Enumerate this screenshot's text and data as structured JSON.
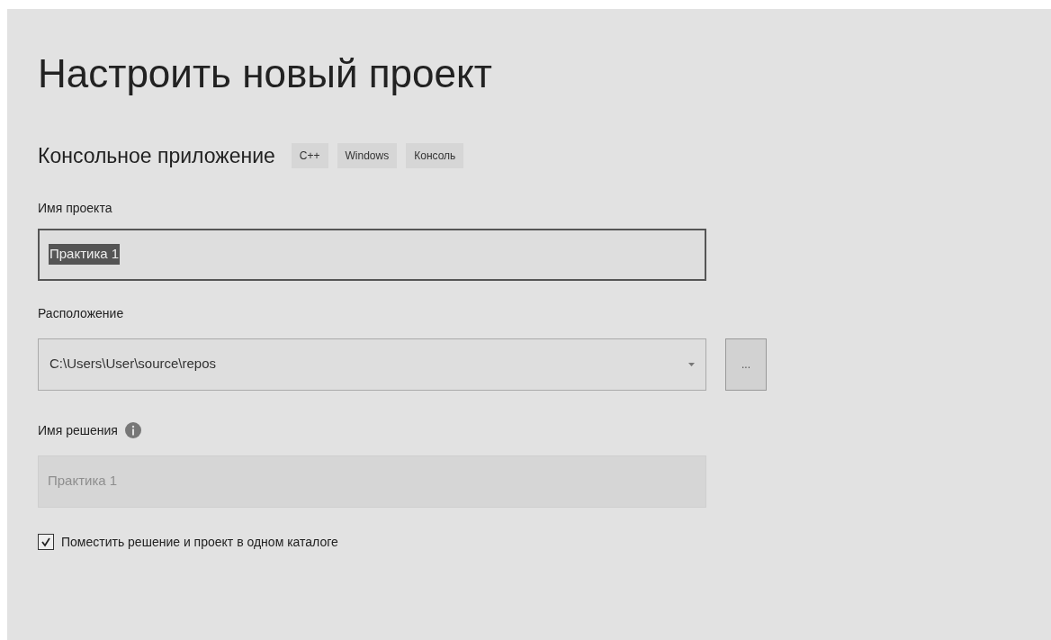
{
  "title": "Настроить новый проект",
  "template": {
    "name": "Консольное приложение",
    "tags": [
      "C++",
      "Windows",
      "Консоль"
    ]
  },
  "project_name": {
    "label": "Имя проекта",
    "value": "Практика 1",
    "selected": true
  },
  "location": {
    "label": "Расположение",
    "value": "C:\\Users\\User\\source\\repos",
    "browse_button": "..."
  },
  "solution_name": {
    "label": "Имя решения",
    "value": "Практика 1",
    "disabled": true
  },
  "same_folder": {
    "label": "Поместить решение и проект в одном каталоге",
    "checked": true
  }
}
